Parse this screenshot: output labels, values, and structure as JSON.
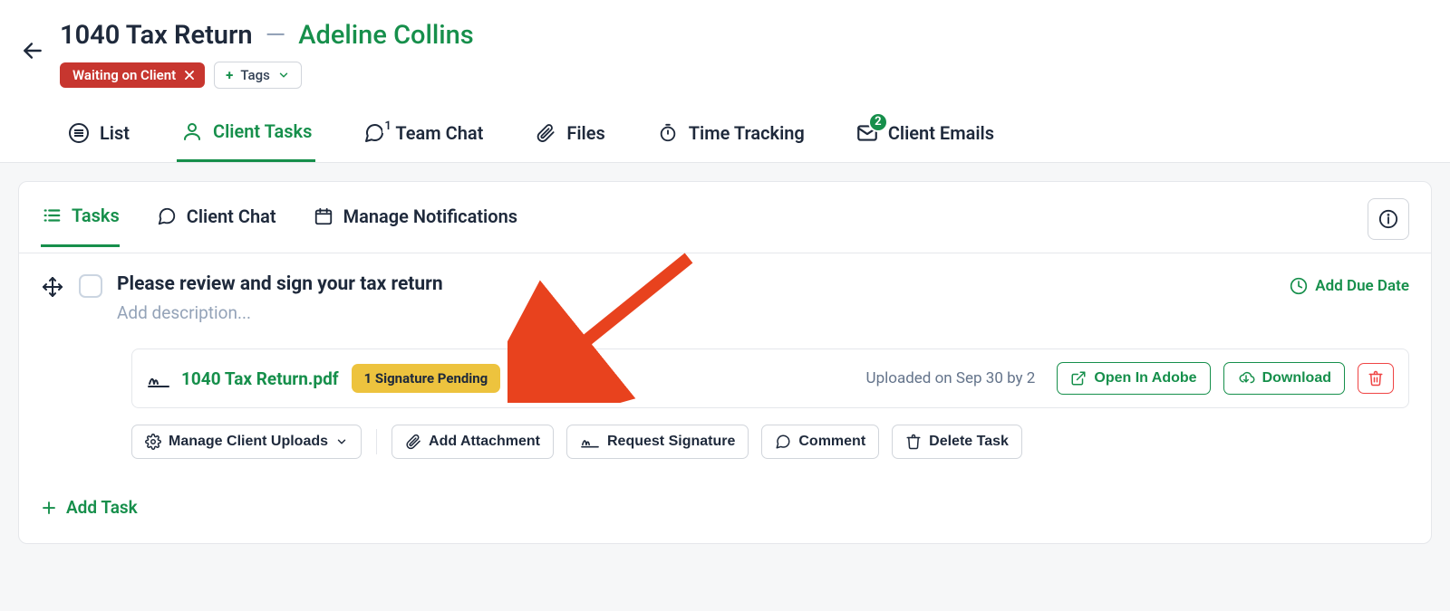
{
  "header": {
    "title": "1040 Tax Return",
    "separator": "—",
    "client_name": "Adeline Collins",
    "status_chip": "Waiting on Client",
    "tags_label": "Tags"
  },
  "main_tabs": {
    "list": "List",
    "client_tasks": "Client Tasks",
    "team_chat": "Team Chat",
    "team_chat_count": "1",
    "files": "Files",
    "time_tracking": "Time Tracking",
    "client_emails": "Client Emails",
    "client_emails_badge": "2"
  },
  "sub_tabs": {
    "tasks": "Tasks",
    "client_chat": "Client Chat",
    "manage_notifications": "Manage Notifications"
  },
  "task": {
    "title": "Please review and sign your tax return",
    "description_placeholder": "Add description...",
    "add_due_date": "Add Due Date"
  },
  "attachment": {
    "filename": "1040 Tax Return.pdf",
    "signature_badge": "1 Signature Pending",
    "uploaded_text": "Uploaded on Sep 30 by 2",
    "open_in_adobe": "Open In Adobe",
    "download": "Download"
  },
  "actions": {
    "manage_client_uploads": "Manage Client Uploads",
    "add_attachment": "Add Attachment",
    "request_signature": "Request Signature",
    "comment": "Comment",
    "delete_task": "Delete Task"
  },
  "add_task": "Add Task",
  "colors": {
    "brand_green": "#168f4b",
    "status_red": "#c7362f",
    "warn_yellow": "#edc33e",
    "danger_red": "#ef4444"
  }
}
